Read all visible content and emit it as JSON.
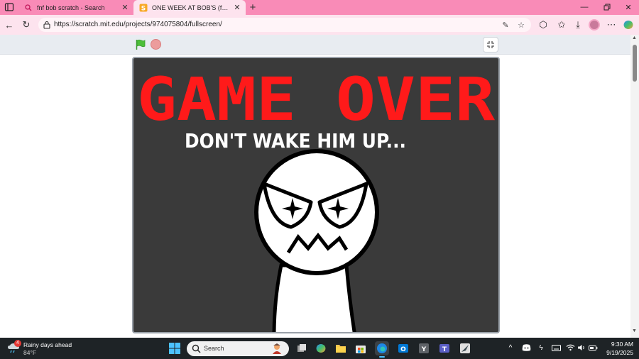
{
  "browser": {
    "tabs": [
      {
        "title": "fnf bob scratch - Search",
        "icon": "search-icon",
        "active": false
      },
      {
        "title": "ONE WEEK AT BOB'S (full version)",
        "icon": "scratch-icon",
        "active": true
      }
    ],
    "url": "https://scratch.mit.edu/projects/974075804/fullscreen/"
  },
  "stage": {
    "title_text": "GAME OVER",
    "subtitle_text": "DON'T WAKE HIM UP..."
  },
  "taskbar": {
    "weather_title": "Rainy days ahead",
    "weather_temp": "84°F",
    "weather_badge": "4",
    "search_placeholder": "Search",
    "time": "9:30 AM",
    "date": "9/19/2025"
  },
  "colors": {
    "tab_strip": "#f98bb7",
    "toolbar": "#fde3ee",
    "stage_background": "#3a3a3a",
    "game_over_red": "#ff1a1a",
    "taskbar": "#1e2326"
  }
}
